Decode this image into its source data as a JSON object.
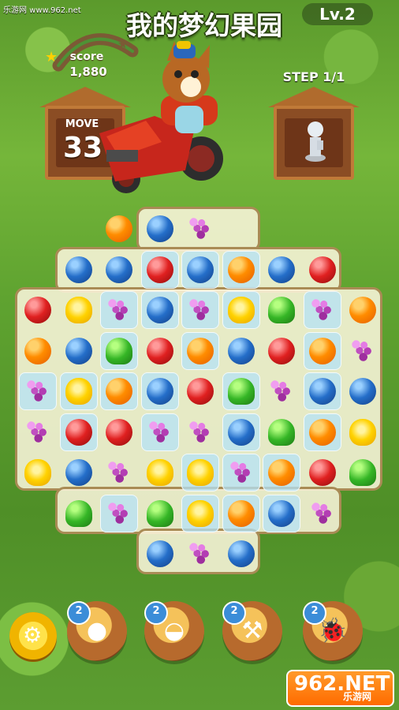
{
  "watermark": "乐游网 www.962.net",
  "title": "我的梦幻果园",
  "level": "Lv.2",
  "score": {
    "label": "score",
    "value": "1,880"
  },
  "moves": {
    "label": "MOVE",
    "value": "33"
  },
  "step": "STEP 1/1",
  "board_rows": [
    [
      "",
      "",
      "orange",
      "blueberry",
      "grape",
      "",
      "",
      "",
      ""
    ],
    [
      "",
      "blueberry",
      "blueberry",
      "apple",
      "blueberry",
      "orange",
      "blueberry",
      "apple",
      ""
    ],
    [
      "apple",
      "pear",
      "grape",
      "blueberry",
      "grape",
      "pear",
      "pepper",
      "grape",
      "orange"
    ],
    [
      "orange",
      "blueberry",
      "pepper",
      "apple",
      "orange",
      "blueberry",
      "apple",
      "orange",
      "grape"
    ],
    [
      "grape",
      "pear",
      "orange",
      "blueberry",
      "apple",
      "pepper",
      "grape",
      "blueberry",
      "blueberry"
    ],
    [
      "grape",
      "apple",
      "apple",
      "grape",
      "grape",
      "blueberry",
      "pepper",
      "orange",
      "pear"
    ],
    [
      "pear",
      "blueberry",
      "grape",
      "pear",
      "pear",
      "grape",
      "orange",
      "apple",
      "pepper"
    ],
    [
      "",
      "pepper",
      "grape",
      "pepper",
      "pear",
      "orange",
      "blueberry",
      "grape",
      ""
    ],
    [
      "",
      "",
      "",
      "blueberry",
      "grape",
      "blueberry",
      "",
      "",
      ""
    ]
  ],
  "tools": [
    {
      "name": "fruit-bag-tool",
      "count": "2",
      "icon": "fruit-bag-icon"
    },
    {
      "name": "basket-tool",
      "count": "2",
      "icon": "basket-icon"
    },
    {
      "name": "hammer-tool",
      "count": "2",
      "icon": "hammer-icon"
    },
    {
      "name": "ladybug-tool",
      "count": "2",
      "icon": "ladybug-icon"
    }
  ],
  "logo": {
    "big": "962.NET",
    "small": "乐游网"
  }
}
